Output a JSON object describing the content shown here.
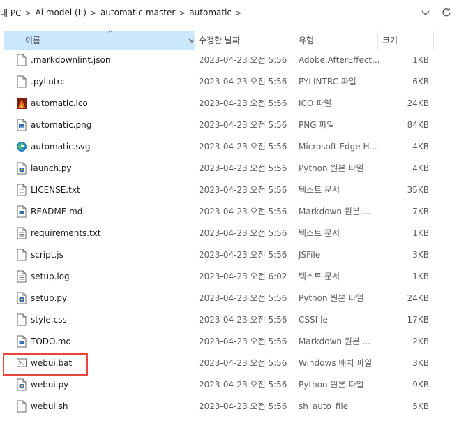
{
  "breadcrumb": [
    "내 PC",
    "Ai model (I:)",
    "automatic-master",
    "automatic"
  ],
  "columns": {
    "name": "이름",
    "date": "수정한 날짜",
    "type": "유형",
    "size": "크기"
  },
  "files": [
    {
      "name": ".markdownlint.json",
      "date": "2023-04-23 오전 5:56",
      "type": "Adobe.AfterEffect...",
      "size": "1KB",
      "icon": "json-file-icon"
    },
    {
      "name": ".pylintrc",
      "date": "2023-04-23 오전 5:56",
      "type": "PYLINTRC 파일",
      "size": "6KB",
      "icon": "blank-file-icon"
    },
    {
      "name": "automatic.ico",
      "date": "2023-04-23 오전 5:56",
      "type": "ICO 파일",
      "size": "24KB",
      "icon": "ico-image-icon"
    },
    {
      "name": "automatic.png",
      "date": "2023-04-23 오전 5:56",
      "type": "PNG 파일",
      "size": "84KB",
      "icon": "png-image-icon"
    },
    {
      "name": "automatic.svg",
      "date": "2023-04-23 오전 5:56",
      "type": "Microsoft Edge H...",
      "size": "4KB",
      "icon": "edge-icon"
    },
    {
      "name": "launch.py",
      "date": "2023-04-23 오전 5:56",
      "type": "Python 원본 파일",
      "size": "4KB",
      "icon": "python-file-icon"
    },
    {
      "name": "LICENSE.txt",
      "date": "2023-04-23 오전 5:56",
      "type": "텍스트 문서",
      "size": "35KB",
      "icon": "text-file-icon"
    },
    {
      "name": "README.md",
      "date": "2023-04-23 오전 5:56",
      "type": "Markdown 원본 ...",
      "size": "7KB",
      "icon": "markdown-file-icon"
    },
    {
      "name": "requirements.txt",
      "date": "2023-04-23 오전 5:56",
      "type": "텍스트 문서",
      "size": "1KB",
      "icon": "text-file-icon"
    },
    {
      "name": "script.js",
      "date": "2023-04-23 오전 5:56",
      "type": "JSFile",
      "size": "3KB",
      "icon": "blank-file-icon"
    },
    {
      "name": "setup.log",
      "date": "2023-04-23 오전 6:02",
      "type": "텍스트 문서",
      "size": "1KB",
      "icon": "text-file-icon"
    },
    {
      "name": "setup.py",
      "date": "2023-04-23 오전 5:56",
      "type": "Python 원본 파일",
      "size": "24KB",
      "icon": "python-file-icon"
    },
    {
      "name": "style.css",
      "date": "2023-04-23 오전 5:56",
      "type": "CSSfile",
      "size": "17KB",
      "icon": "blank-file-icon"
    },
    {
      "name": "TODO.md",
      "date": "2023-04-23 오전 5:56",
      "type": "Markdown 원본 ...",
      "size": "2KB",
      "icon": "markdown-file-icon"
    },
    {
      "name": "webui.bat",
      "date": "2023-04-23 오전 5:56",
      "type": "Windows 배치 파일",
      "size": "3KB",
      "icon": "batch-file-icon"
    },
    {
      "name": "webui.py",
      "date": "2023-04-23 오전 5:56",
      "type": "Python 원본 파일",
      "size": "9KB",
      "icon": "python-file-icon"
    },
    {
      "name": "webui.sh",
      "date": "2023-04-23 오전 5:56",
      "type": "sh_auto_file",
      "size": "5KB",
      "icon": "blank-file-icon"
    }
  ],
  "colors": {
    "header_selected": "#cce8ff",
    "highlight_box": "#e8453c",
    "python_blue": "#3a6fb0",
    "ico_orange": "#e8701a"
  }
}
